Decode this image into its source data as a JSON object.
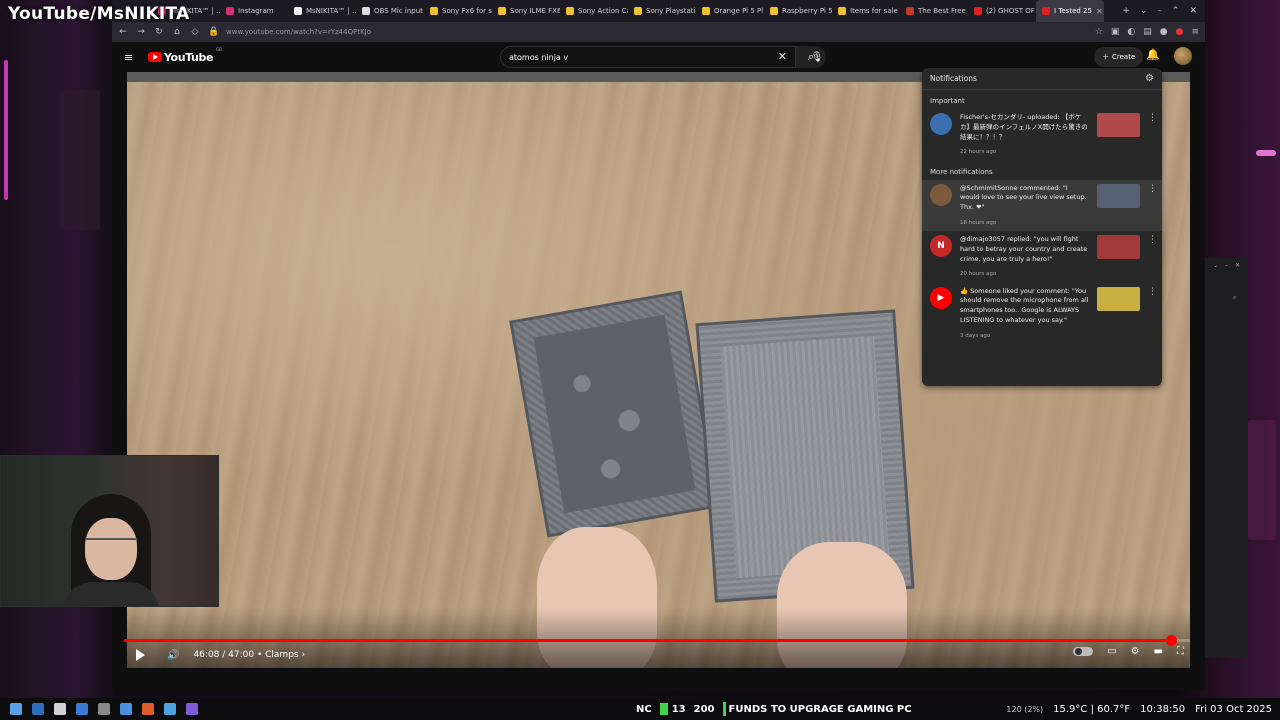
{
  "overlay": {
    "channel_handle": "YouTube/MsNIKITA"
  },
  "browser": {
    "tabs": [
      {
        "label": "MsNIKITA™ | ...",
        "color": "#e0306c"
      },
      {
        "label": "Instagram",
        "color": "#d6307a"
      },
      {
        "label": "MsNIKITA™ | ...",
        "color": "#eeeeee"
      },
      {
        "label": "OBS Mic input",
        "color": "#dddddd"
      },
      {
        "label": "Sony Fx6 for s",
        "color": "#f2c230"
      },
      {
        "label": "Sony ILME FX6",
        "color": "#f2c230"
      },
      {
        "label": "Sony Action Ca",
        "color": "#f2c230"
      },
      {
        "label": "Sony Playstatio",
        "color": "#f2c230"
      },
      {
        "label": "Orange Pi 5 Pl",
        "color": "#f2c230"
      },
      {
        "label": "Raspberry Pi 5",
        "color": "#f2c230"
      },
      {
        "label": "Items for sale",
        "color": "#f2c230"
      },
      {
        "label": "The Best Free",
        "color": "#c0392b"
      },
      {
        "label": "(2) GHOST OF",
        "color": "#e02020"
      },
      {
        "label": "I Tested 25",
        "color": "#e02020",
        "active": true
      }
    ],
    "url": "www.youtube.com/watch?v=rYz44QPtKJo"
  },
  "youtube": {
    "logo_text": "YouTube",
    "region": "GB",
    "search_value": "atomos ninja v",
    "create_label": "Create"
  },
  "player": {
    "time": "46:08 / 47:00",
    "chapter": "Clamps",
    "progress_fraction": 0.982
  },
  "notifications": {
    "title": "Notifications",
    "important_label": "Important",
    "more_label": "More notifications",
    "important": [
      {
        "text": "Fischer's-セカンダリ- uploaded: 【ボケカ】最新弾のインフェルノX開けたら驚きの結果に！？！？",
        "time": "22 hours ago",
        "avatar_color": "#3a6fb0",
        "thumb_color": "#b04a4a"
      }
    ],
    "more": [
      {
        "text": "@SchmimitSonne commented: \"I would love to see your live view setup. Thx. ❤\"",
        "time": "18 hours ago",
        "avatar_color": "#7a5a3a",
        "thumb_color": "#556070",
        "avatar_letter": ""
      },
      {
        "text": "@dimajo3057 replied: \"you will fight hard to betray your country and create crime, you are truly a hero!\"",
        "time": "20 hours ago",
        "avatar_color": "#c62828",
        "thumb_color": "#a33a3a",
        "avatar_letter": "N"
      },
      {
        "text": "👍 Someone liked your comment: \"You should remove the microphone from all smartphones too.. Google is ALWAYS LISTENING to whatever you say.\"",
        "time": "3 days ago",
        "avatar_color": "#ff0000",
        "thumb_color": "#c8b040",
        "avatar_letter": "▶"
      }
    ]
  },
  "taskbar": {
    "nc_label": "NC",
    "count_a": "13",
    "count_b": "200",
    "goal_text": "FUNDS TO UPGRAGE GAMING PC",
    "cpu": "120 (2%)",
    "temperature": "15.9°C | 60.7°F",
    "clock": "10:38:50",
    "date": "Fri 03 Oct 2025"
  }
}
